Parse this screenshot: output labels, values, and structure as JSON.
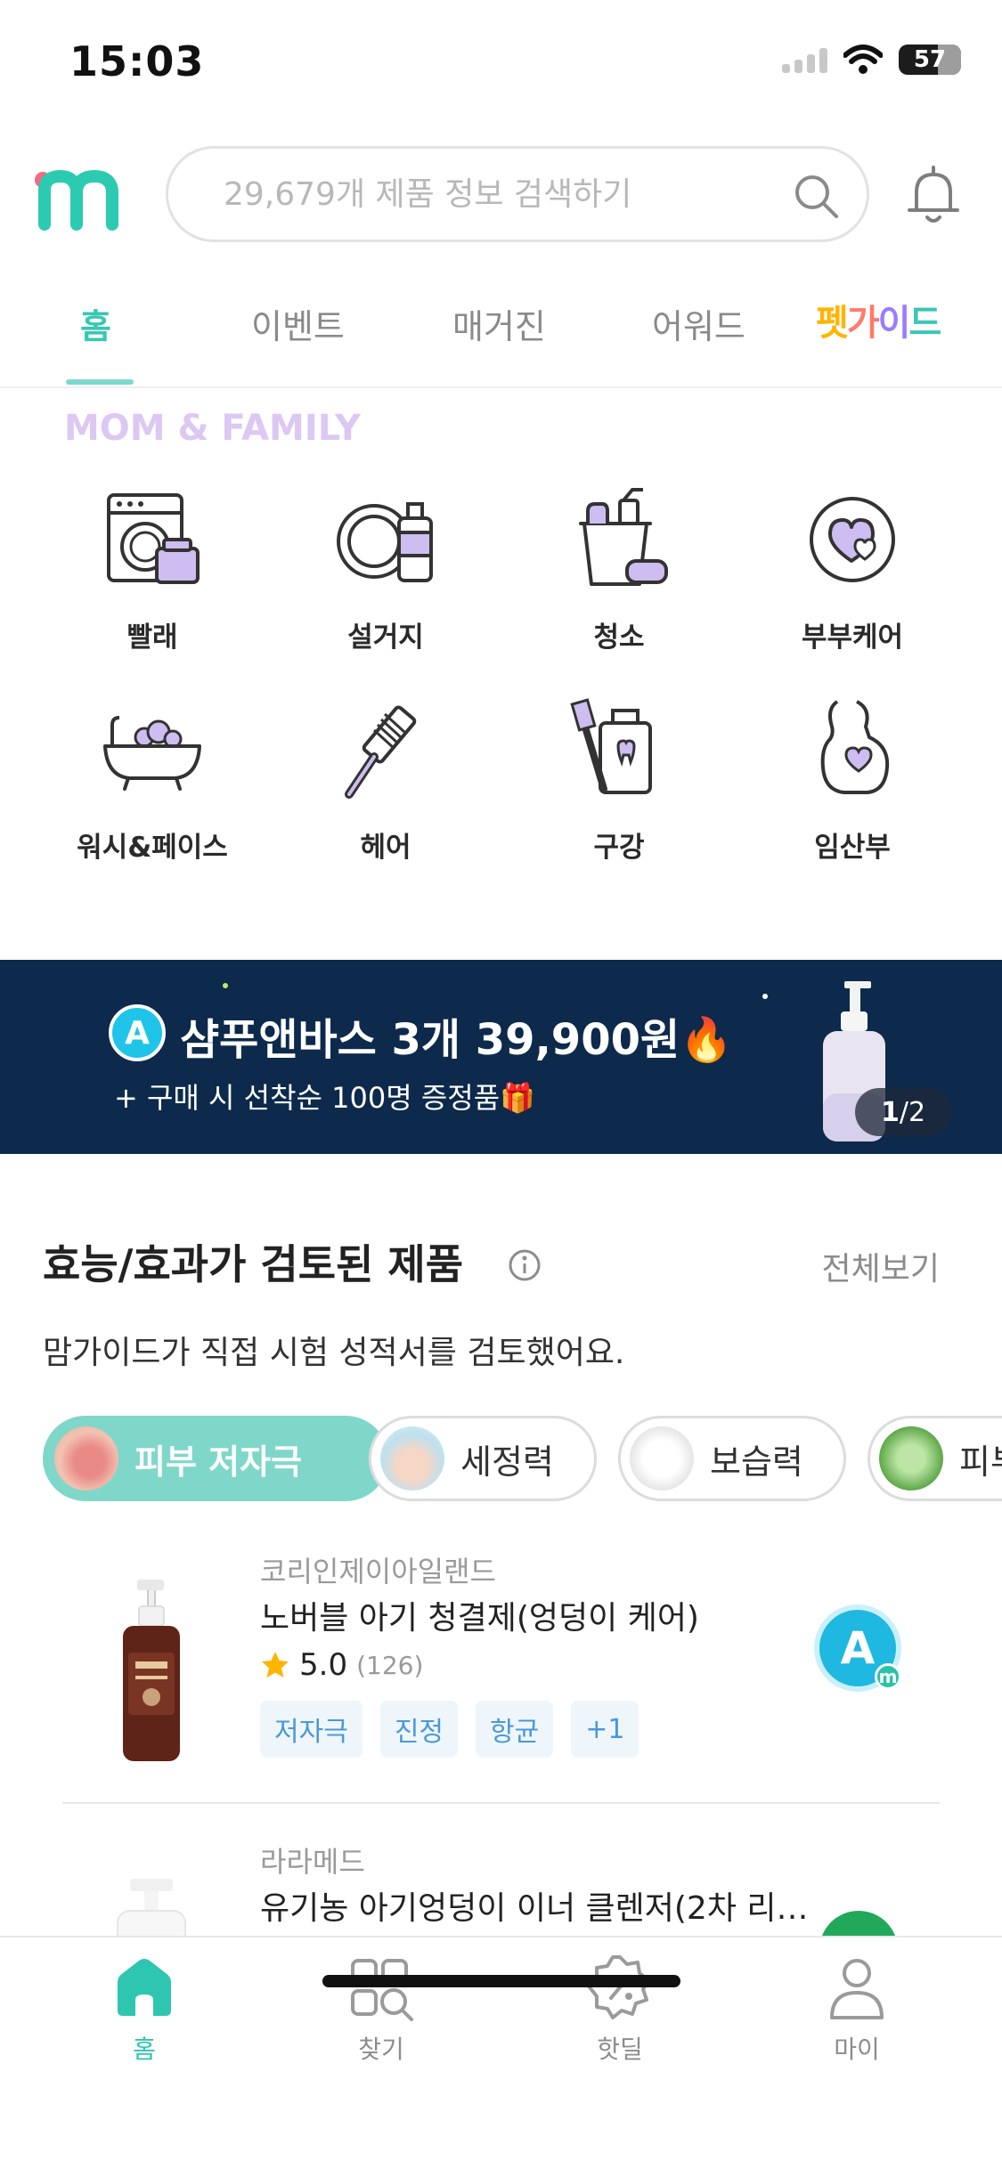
{
  "status_bar": {
    "time": "15:03",
    "battery": "57"
  },
  "header": {
    "search_placeholder": "29,679개 제품 정보 검색하기"
  },
  "tabs": [
    {
      "label": "홈",
      "active": true
    },
    {
      "label": "이벤트"
    },
    {
      "label": "매거진"
    },
    {
      "label": "어워드"
    },
    {
      "label": "펫가이드"
    }
  ],
  "mom_family": {
    "title": "MOM & FAMILY",
    "categories": [
      {
        "label": "빨래",
        "icon": "washing-machine-icon"
      },
      {
        "label": "설거지",
        "icon": "dish-icon"
      },
      {
        "label": "청소",
        "icon": "cleaning-bucket-icon"
      },
      {
        "label": "부부케어",
        "icon": "heart-icon"
      },
      {
        "label": "워시&페이스",
        "icon": "bathtub-icon"
      },
      {
        "label": "헤어",
        "icon": "comb-icon"
      },
      {
        "label": "구강",
        "icon": "toothbrush-icon"
      },
      {
        "label": "임산부",
        "icon": "pregnant-icon"
      }
    ]
  },
  "banner": {
    "badge": "A",
    "title": "샴푸앤바스 3개 39,900원🔥",
    "subtitle": "+ 구매 시 선착순 100명 증정품🎁",
    "pager_current": "1",
    "pager_sep": " / ",
    "pager_total": "2"
  },
  "reviewed": {
    "title": "효능/효과가 검토된 제품",
    "see_all": "전체보기",
    "description": "맘가이드가 직접 시험 성적서를 검토했어요.",
    "chips": [
      {
        "label": "피부 저자극",
        "active": true
      },
      {
        "label": "세정력"
      },
      {
        "label": "보습력"
      },
      {
        "label": "피부"
      }
    ],
    "products": [
      {
        "brand": "코리인제이아일랜드",
        "name": "노버블 아기 청결제(엉덩이 케어)",
        "rating": "5.0",
        "reviews": "(126)",
        "tags": [
          "저자극",
          "진정",
          "항균",
          "+1"
        ],
        "badge": "A",
        "badge_sub": "m"
      },
      {
        "brand": "라라메드",
        "name": "유기농 아기엉덩이 이너 클렌저(2차 리…"
      }
    ]
  },
  "bottom_nav": [
    {
      "label": "홈",
      "active": true
    },
    {
      "label": "찾기"
    },
    {
      "label": "핫딜"
    },
    {
      "label": "마이"
    }
  ],
  "colors": {
    "accent": "#36c8b3",
    "banner_bg": "#0d2a4c",
    "mom_title": "#dcc8f3",
    "icon_purple": "#cdbdf0"
  }
}
